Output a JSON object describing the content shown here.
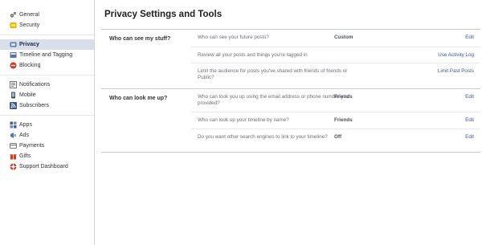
{
  "sidebar": {
    "groups": [
      [
        {
          "label": "General",
          "icon": "gears-icon"
        },
        {
          "label": "Security",
          "icon": "shield-badge-icon"
        }
      ],
      [
        {
          "label": "Privacy",
          "icon": "lock-icon",
          "selected": true
        },
        {
          "label": "Timeline and Tagging",
          "icon": "timeline-icon"
        },
        {
          "label": "Blocking",
          "icon": "block-icon"
        }
      ],
      [
        {
          "label": "Notifications",
          "icon": "notifications-icon"
        },
        {
          "label": "Mobile",
          "icon": "mobile-icon"
        },
        {
          "label": "Subscribers",
          "icon": "rss-icon"
        }
      ],
      [
        {
          "label": "Apps",
          "icon": "apps-icon"
        },
        {
          "label": "Ads",
          "icon": "ads-icon"
        },
        {
          "label": "Payments",
          "icon": "payments-icon"
        },
        {
          "label": "Gifts",
          "icon": "gift-icon"
        },
        {
          "label": "Support Dashboard",
          "icon": "lifebuoy-icon"
        }
      ]
    ]
  },
  "main": {
    "title": "Privacy Settings and Tools",
    "sections": [
      {
        "label": "Who can see my stuff?",
        "rows": [
          {
            "question": "Who can see your future posts?",
            "value": "Custom",
            "action": "Edit"
          },
          {
            "question": "Review all your posts and things you're tagged in",
            "value": "",
            "action": "Use Activity Log"
          },
          {
            "question": "Limit the audience for posts you've shared with friends of friends or Public?",
            "value": "",
            "action": "Limit Past Posts"
          }
        ]
      },
      {
        "label": "Who can look me up?",
        "rows": [
          {
            "question": "Who can look you up using the email address or phone number you provided?",
            "value": "Friends",
            "action": "Edit"
          },
          {
            "question": "Who can look up your timeline by name?",
            "value": "Friends",
            "action": "Edit"
          },
          {
            "question": "Do you want other search engines to link to your timeline?",
            "value": "Off",
            "action": "Edit"
          }
        ]
      }
    ]
  },
  "colors": {
    "link": "#3b5998",
    "selected_bg": "#d8dfea",
    "rule": "#c4c9d3"
  }
}
